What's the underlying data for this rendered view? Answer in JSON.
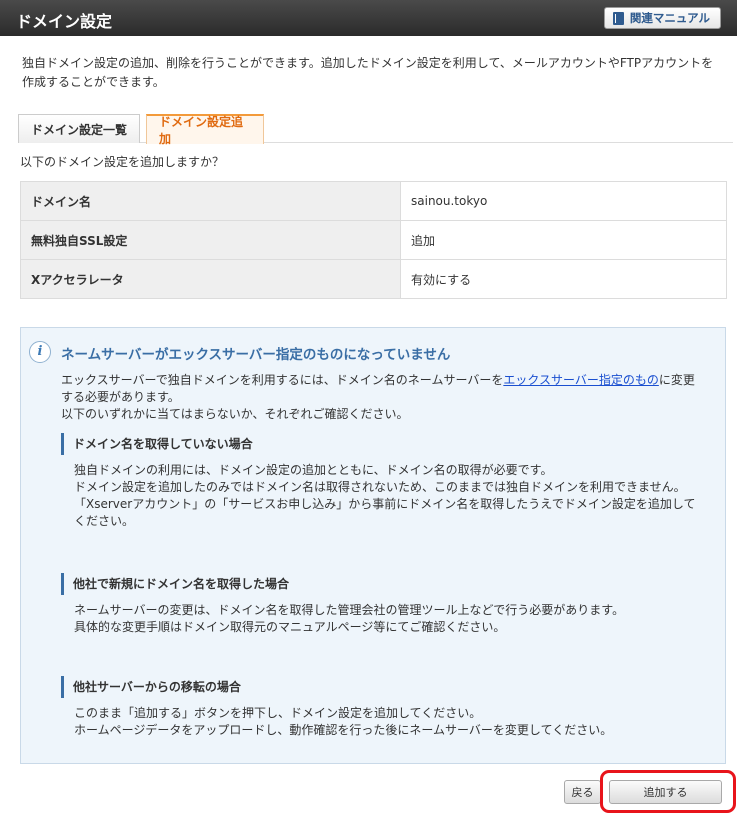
{
  "header": {
    "title": "ドメイン設定",
    "manual_label": "関連マニュアル"
  },
  "intro_text": "独自ドメイン設定の追加、削除を行うことができます。追加したドメイン設定を利用して、メールアカウントやFTPアカウントを作成することができます。",
  "tabs": [
    {
      "label": "ドメイン設定一覧",
      "active": false
    },
    {
      "label": "ドメイン設定追加",
      "active": true
    }
  ],
  "question": "以下のドメイン設定を追加しますか？",
  "table": [
    {
      "key": "ドメイン名",
      "value": "sainou.tokyo"
    },
    {
      "key": "無料独自SSL設定",
      "value": "追加"
    },
    {
      "key": "Xアクセラレータ",
      "value": "有効にする"
    }
  ],
  "notice": {
    "icon": "info-icon",
    "title": "ネームサーバーがエックスサーバー指定のものになっていません",
    "text_before": "エックスサーバーで独自ドメインを利用するには、ドメイン名のネームサーバーを",
    "link": "エックスサーバー指定のもの",
    "text_after": "に変更する必要があります。",
    "text_line2": "以下のいずれかに当てはまらないか、それぞれご確認ください。",
    "sections": [
      {
        "heading": "ドメイン名を取得していない場合",
        "lines": [
          "独自ドメインの利用には、ドメイン設定の追加とともに、ドメイン名の取得が必要です。",
          "ドメイン設定を追加したのみではドメイン名は取得されないため、このままでは独自ドメインを利用できません。",
          "「Xserverアカウント」の「サービスお申し込み」から事前にドメイン名を取得したうえでドメイン設定を追加してください。"
        ]
      },
      {
        "heading": "他社で新規にドメイン名を取得した場合",
        "lines": [
          "ネームサーバーの変更は、ドメイン名を取得した管理会社の管理ツール上などで行う必要があります。",
          "具体的な変更手順はドメイン取得元のマニュアルページ等にてご確認ください。"
        ]
      },
      {
        "heading": "他社サーバーからの移転の場合",
        "lines": [
          "このまま「追加する」ボタンを押下し、ドメイン設定を追加してください。",
          "ホームページデータをアップロードし、動作確認を行った後にネームサーバーを変更してください。"
        ]
      }
    ]
  },
  "buttons": {
    "back": "戻る",
    "add": "追加する"
  },
  "colors": {
    "highlight": "#e8141b",
    "active_tab": "#e06a10",
    "notice_title": "#3a6ea5"
  }
}
